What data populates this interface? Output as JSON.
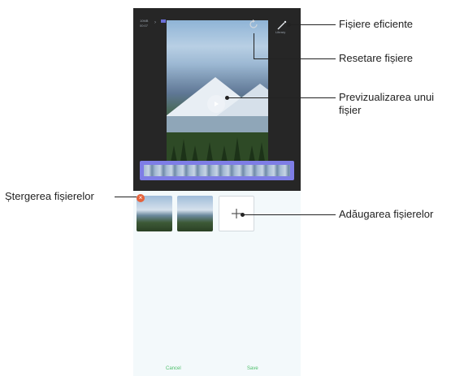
{
  "callouts": {
    "efficient_files": "Fișiere eficiente",
    "reset_file": "Resetare fișiere",
    "preview_line1": "Previzualizarea unui",
    "preview_line2": "fișier",
    "delete_files": "Ștergerea fișierelor",
    "add_files": "Adăugarea fișierelor"
  },
  "phone": {
    "top_left_line1": "10MB",
    "top_left_line2": "00:07",
    "efficient_label": "Library",
    "cancel_label": "Cancel",
    "save_label": "Save"
  },
  "colors": {
    "strip": "#7e7de6",
    "delete_badge": "#e5623b",
    "bottom_button_text": "#4dbf6a",
    "panel_background": "#f3f9fb"
  },
  "icons": {
    "reset": "reset-icon",
    "efficient": "magic-wand-icon",
    "play": "play-icon",
    "delete": "close-icon",
    "add": "plus-icon"
  }
}
